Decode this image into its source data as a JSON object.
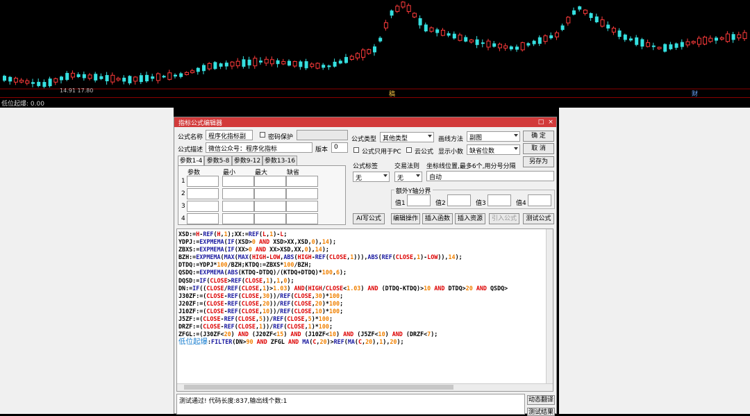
{
  "chart": {
    "top_marker": "稿",
    "right_marker": "财",
    "price_label": "14.91  17.80",
    "subpanel_title": "低位起爆: 0.00"
  },
  "dialog": {
    "title": "指标公式编辑器",
    "minimize_icon": "□",
    "close_icon": "×",
    "name_label": "公式名称",
    "name_value": "程序化指标副",
    "password_label": "密码保护",
    "desc_label": "公式描述",
    "desc_value": "微信公众号：程序化指标",
    "version_label": "版本",
    "version_value": "0",
    "type_label": "公式类型",
    "type_value": "其他类型",
    "draw_label": "画线方法",
    "draw_value": "副图",
    "pc_only_label": "公式只用于PC",
    "cloud_label": "云公式",
    "decimals_label": "显示小数",
    "decimals_value": "缺省位数",
    "ok_button": "确 定",
    "cancel_button": "取 消",
    "saveas_button": "另存为",
    "tabs": [
      "参数1-4",
      "参数5-8",
      "参数9-12",
      "参数13-16"
    ],
    "param_headers": [
      "参数",
      "最小",
      "最大",
      "缺省"
    ],
    "param_rows": [
      "1",
      "2",
      "3",
      "4"
    ],
    "tag_label": "公式标签",
    "tag_value": "无",
    "trade_label": "交易法则",
    "trade_value": "无",
    "coord_label": "坐标线位置,最多6个,用分号分隔",
    "coord_value": "自动",
    "yaxis_label": "额外Y轴分界",
    "y_values": [
      "值1",
      "值2",
      "值3",
      "值4"
    ],
    "ai_button": "AI写公式",
    "edit_button": "编辑操作",
    "insert_func_button": "插入函数",
    "insert_res_button": "插入资源",
    "import_button": "引入公式",
    "test_button": "测试公式",
    "status_text": "测试通过! 代码长度:837,输出线个数:1",
    "dyn_translate_button": "动态翻译",
    "test_result_button": "测试结果"
  }
}
